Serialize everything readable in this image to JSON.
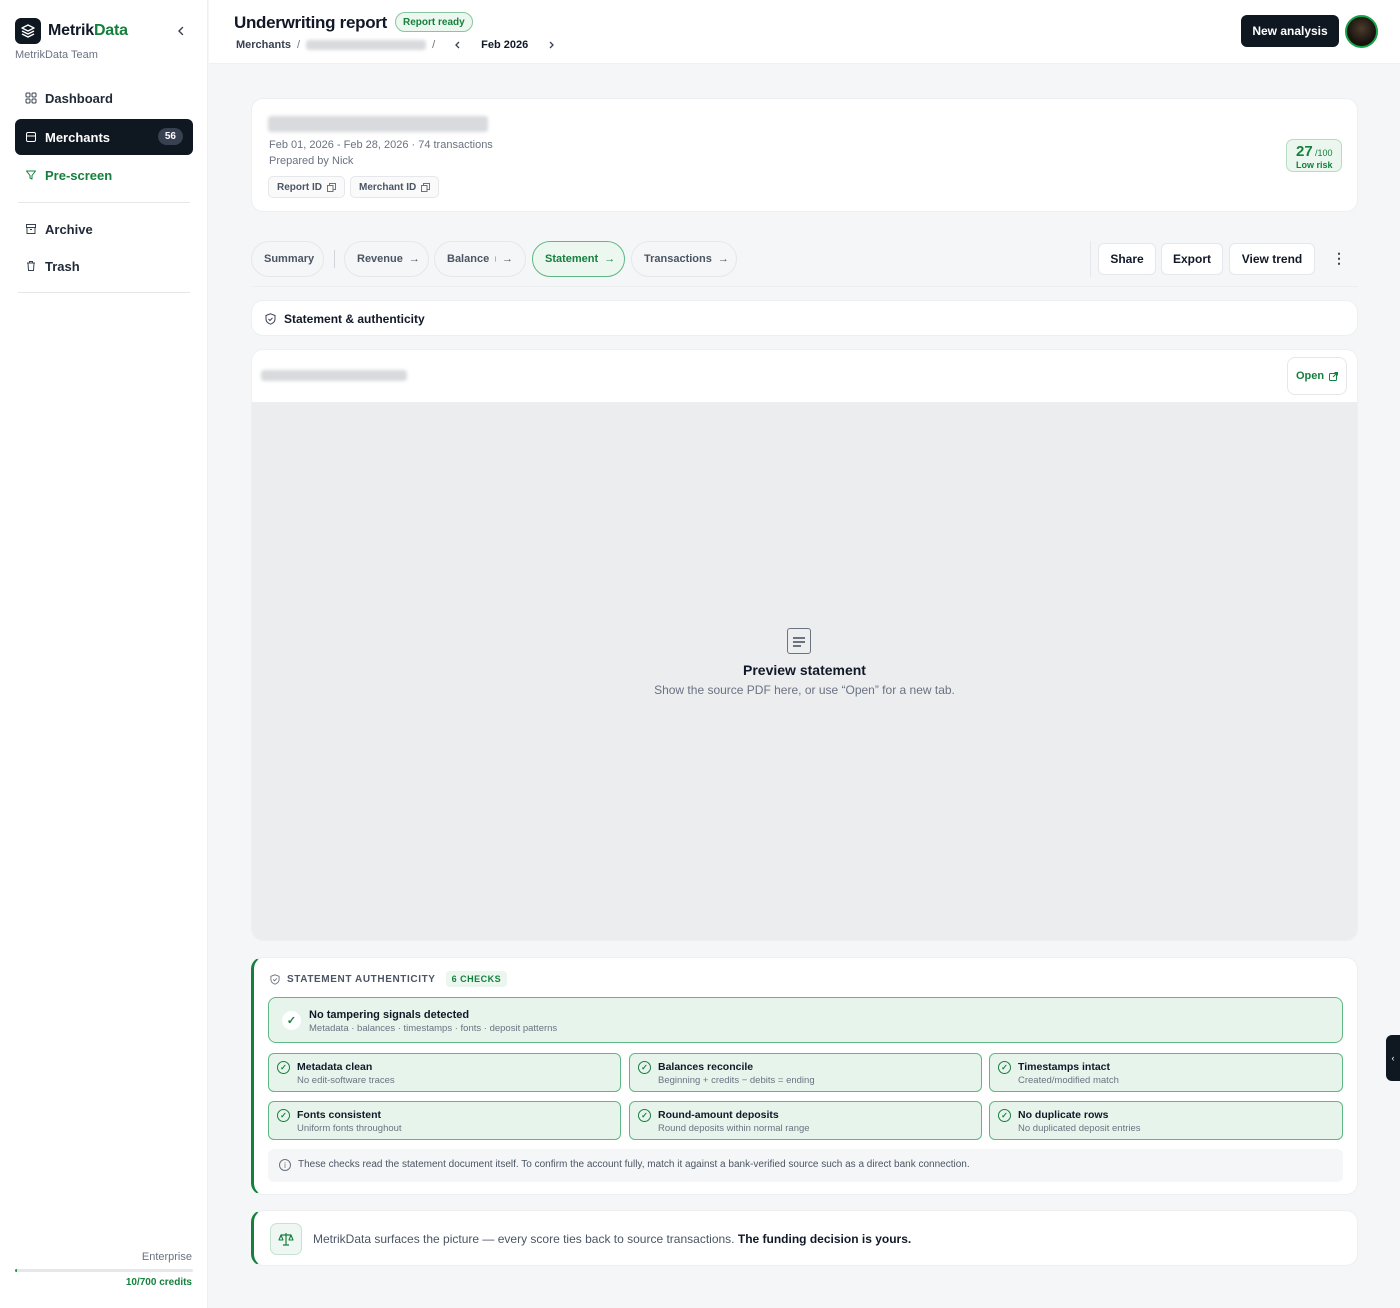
{
  "app": {
    "brand_first": "Metrik",
    "brand_second": "Data",
    "team": "MetrikData Team",
    "accent": "#15803d"
  },
  "sidebar": {
    "items": [
      {
        "label": "Dashboard",
        "icon": "grid-icon"
      },
      {
        "label": "Merchants",
        "icon": "store-icon",
        "badge": "56",
        "active": true
      },
      {
        "label": "Pre-screen",
        "icon": "filter-icon"
      },
      {
        "label": "Archive",
        "icon": "archive-icon"
      },
      {
        "label": "Trash",
        "icon": "trash-icon"
      }
    ],
    "plan": "Enterprise",
    "credits_text": "10/700 credits",
    "credits_used_fraction": 0.014
  },
  "header": {
    "title": "Underwriting report",
    "status": "Report ready",
    "breadcrumb_root": "Merchants",
    "period": "Feb 2026",
    "new_button": "New analysis"
  },
  "merchant": {
    "date_range": "Feb 01, 2026 - Feb 28, 2026 · 74 transactions",
    "prepared_label": "Prepared by",
    "prepared_by": "Nick",
    "report_id_label": "Report ID",
    "merchant_id_label": "Merchant ID",
    "score": "27",
    "score_max": "/100",
    "risk_label": "Low risk"
  },
  "tabs": {
    "summary": "Summary",
    "revenue": "Revenue",
    "balance": "Balance",
    "statement": "Statement",
    "transactions": "Transactions",
    "arrow": "→",
    "active": "Statement"
  },
  "actions": {
    "share": "Share",
    "export": "Export",
    "view_trend": "View trend"
  },
  "statement": {
    "section_title": "Statement & authenticity",
    "open_label": "Open",
    "preview_title": "Preview statement",
    "preview_subtitle": "Show the source PDF here, or use “Open” for a new tab."
  },
  "authenticity": {
    "title": "STATEMENT AUTHENTICITY",
    "count": "6 CHECKS",
    "summary_title": "No tampering signals detected",
    "summary_sub": "Metadata · balances · timestamps · fonts · deposit patterns",
    "checks": [
      {
        "title": "Metadata clean",
        "sub": "No edit-software traces"
      },
      {
        "title": "Balances reconcile",
        "sub": "Beginning + credits − debits = ending"
      },
      {
        "title": "Timestamps intact",
        "sub": "Created/modified match"
      },
      {
        "title": "Fonts consistent",
        "sub": "Uniform fonts throughout"
      },
      {
        "title": "Round-amount deposits",
        "sub": "Round deposits within normal range"
      },
      {
        "title": "No duplicate rows",
        "sub": "No duplicated deposit entries"
      }
    ],
    "note": "These checks read the statement document itself. To confirm the account fully, match it against a bank-verified source such as a direct bank connection."
  },
  "footer": {
    "text": "MetrikData surfaces the picture — every score ties back to source transactions.",
    "emphasis": "The funding decision is yours."
  }
}
